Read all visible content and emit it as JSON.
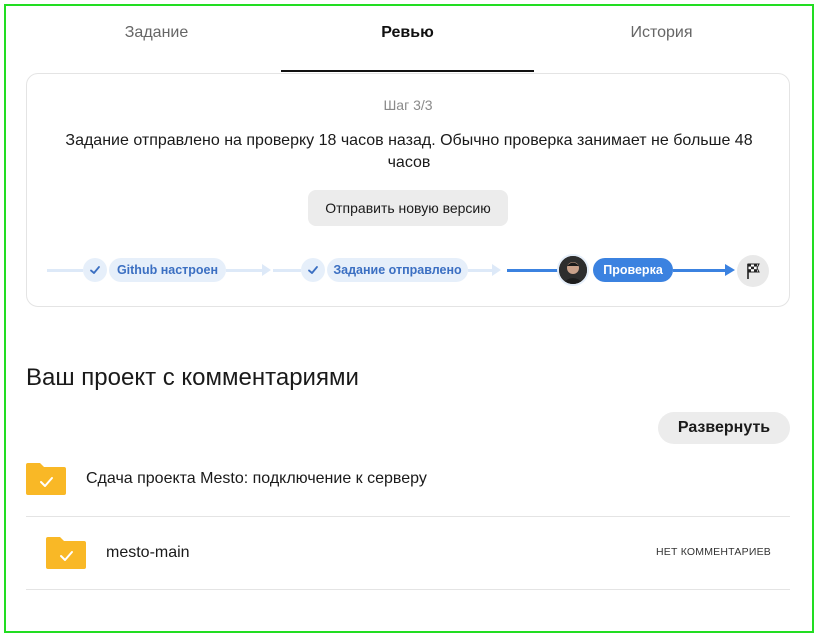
{
  "tabs": {
    "task": "Задание",
    "review": "Ревью",
    "history": "История"
  },
  "review_card": {
    "step": "Шаг 3/3",
    "message": "Задание отправлено на проверку 18 часов назад. Обычно проверка занимает не больше 48 часов",
    "send_button": "Отправить новую версию",
    "progress": {
      "step1": "Github настроен",
      "step2": "Задание отправлено",
      "step3": "Проверка"
    }
  },
  "project": {
    "title": "Ваш проект с комментариями",
    "expand_button": "Развернуть",
    "root_folder": "Сдача проекта Mesto: подключение к серверу",
    "subfolder": "mesto-main",
    "subfolder_status": "НЕТ КОММЕНТАРИЕВ"
  },
  "colors": {
    "accent": "#3b82e0",
    "folder": "#f9b826",
    "frame": "#22dd22"
  }
}
